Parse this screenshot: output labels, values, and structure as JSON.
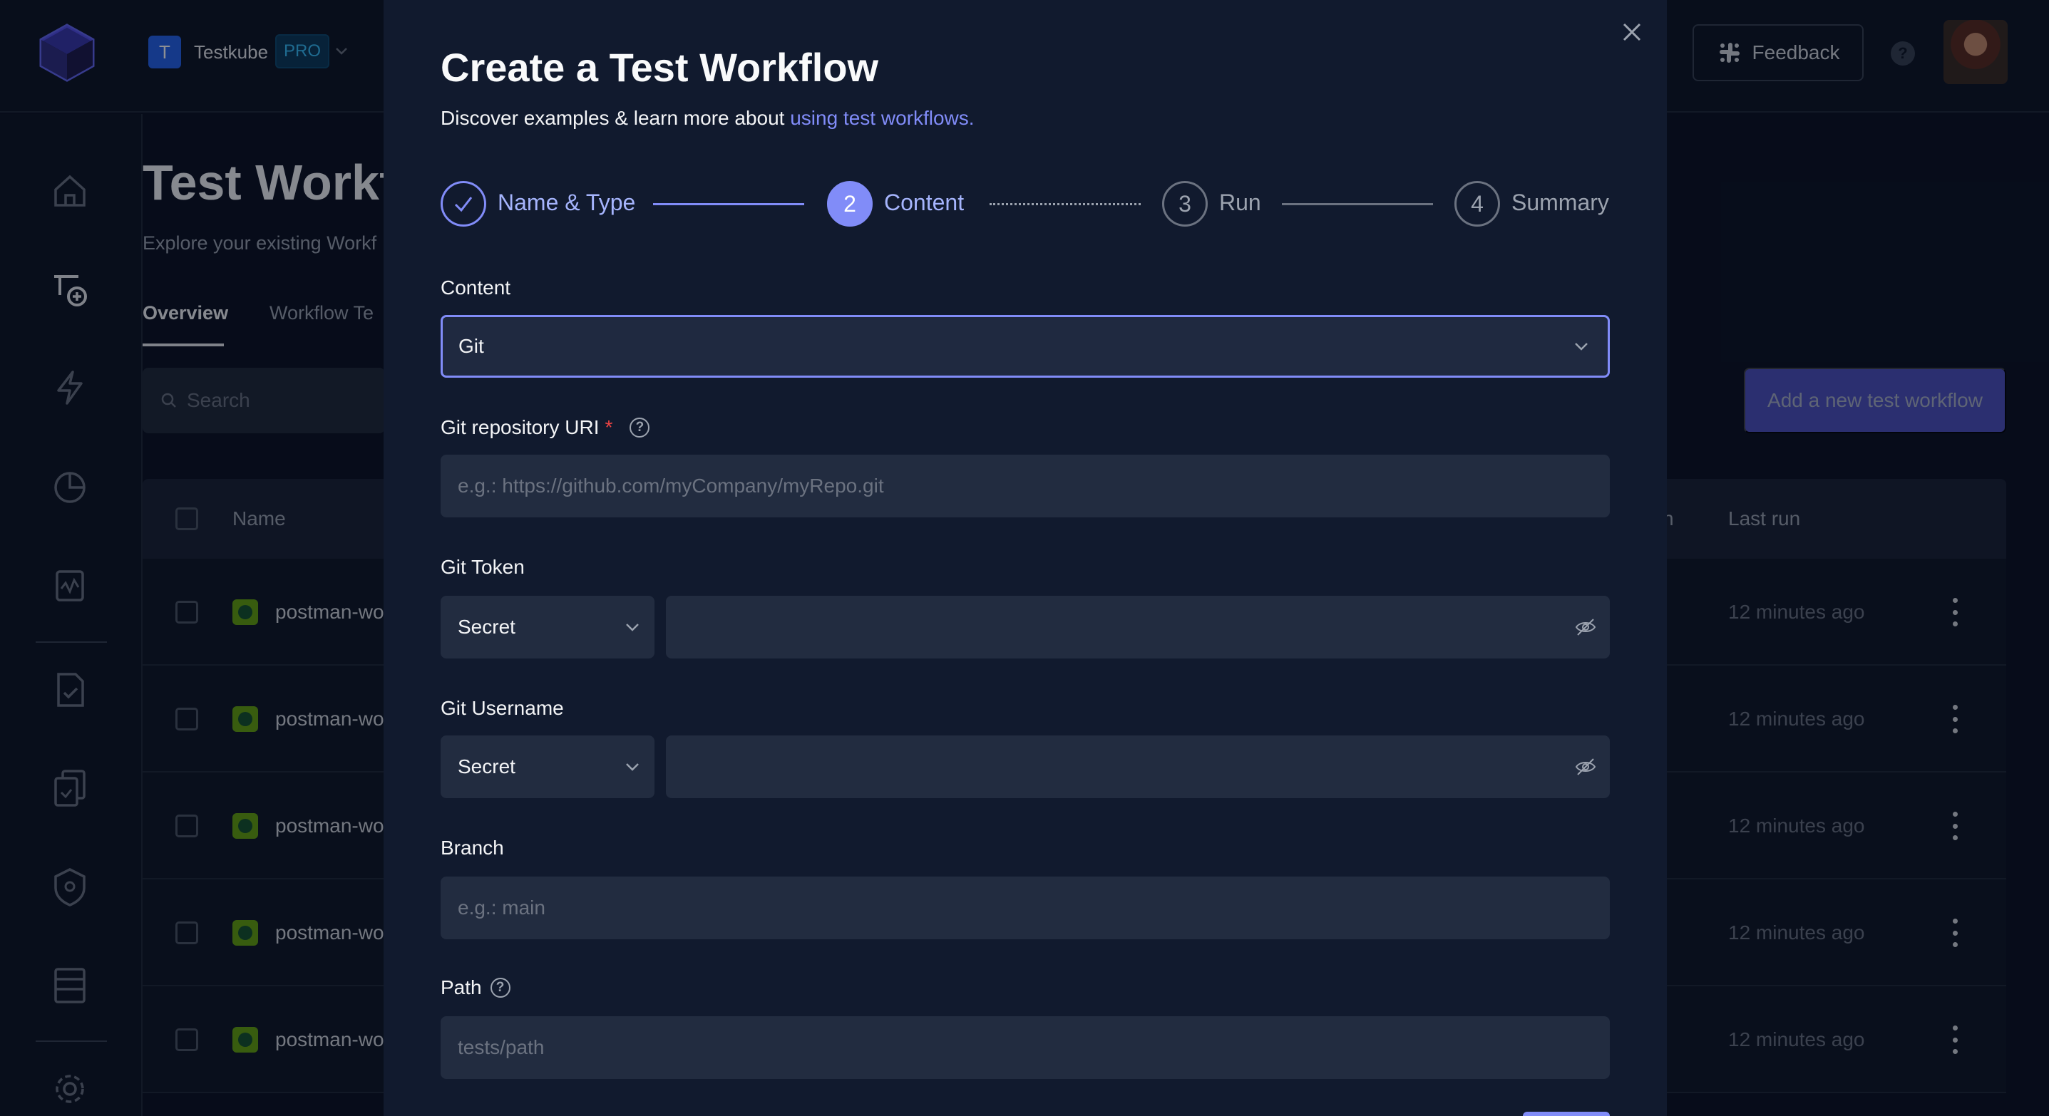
{
  "app": {
    "org_initial": "T",
    "org_name": "Testkube",
    "plan_badge": "PRO",
    "feedback_label": "Feedback",
    "help_glyph": "?"
  },
  "sidenav": {
    "items": [
      "home-icon",
      "test-workflows-icon",
      "triggers-icon",
      "analytics-icon",
      "status-pages-icon",
      "tests-icon",
      "test-suites-icon",
      "security-icon",
      "environments-icon",
      "settings-icon"
    ]
  },
  "page": {
    "title": "Test Workfl",
    "subtitle": "Explore your existing Workf",
    "tabs": [
      {
        "label": "Overview",
        "active": true
      },
      {
        "label": "Workflow Te",
        "active": false
      }
    ],
    "search_placeholder": "Search",
    "add_button": "Add a new test workflow"
  },
  "table": {
    "columns": {
      "name": "Name",
      "partial": "n",
      "last_run": "Last run"
    },
    "rows": [
      {
        "name": "postman-wo",
        "last_run": "12 minutes ago"
      },
      {
        "name": "postman-wo",
        "last_run": "12 minutes ago"
      },
      {
        "name": "postman-wo",
        "last_run": "12 minutes ago"
      },
      {
        "name": "postman-wo",
        "last_run": "12 minutes ago"
      },
      {
        "name": "postman-wo",
        "last_run": "12 minutes ago"
      }
    ]
  },
  "modal": {
    "title": "Create a Test Workflow",
    "subtitle_text": "Discover examples & learn more about ",
    "subtitle_link": "using test workflows.",
    "steps": [
      {
        "number": "",
        "label": "Name & Type",
        "state": "done"
      },
      {
        "number": "2",
        "label": "Content",
        "state": "active"
      },
      {
        "number": "3",
        "label": "Run",
        "state": "pending"
      },
      {
        "number": "4",
        "label": "Summary",
        "state": "pending"
      }
    ],
    "fields": {
      "content": {
        "label": "Content",
        "value": "Git"
      },
      "git_uri": {
        "label": "Git repository URI",
        "required_mark": "*",
        "placeholder": "e.g.: https://github.com/myCompany/myRepo.git",
        "value": ""
      },
      "git_token": {
        "label": "Git Token",
        "type_value": "Secret",
        "value": ""
      },
      "git_username": {
        "label": "Git Username",
        "type_value": "Secret",
        "value": ""
      },
      "branch": {
        "label": "Branch",
        "placeholder": "e.g.: main",
        "value": ""
      },
      "path": {
        "label": "Path",
        "placeholder": "tests/path",
        "value": ""
      }
    }
  },
  "colors": {
    "accent": "#818cf8",
    "background": "#0b1222",
    "modal": "#111a2e",
    "input": "#222c40",
    "success": "#65a30d"
  }
}
